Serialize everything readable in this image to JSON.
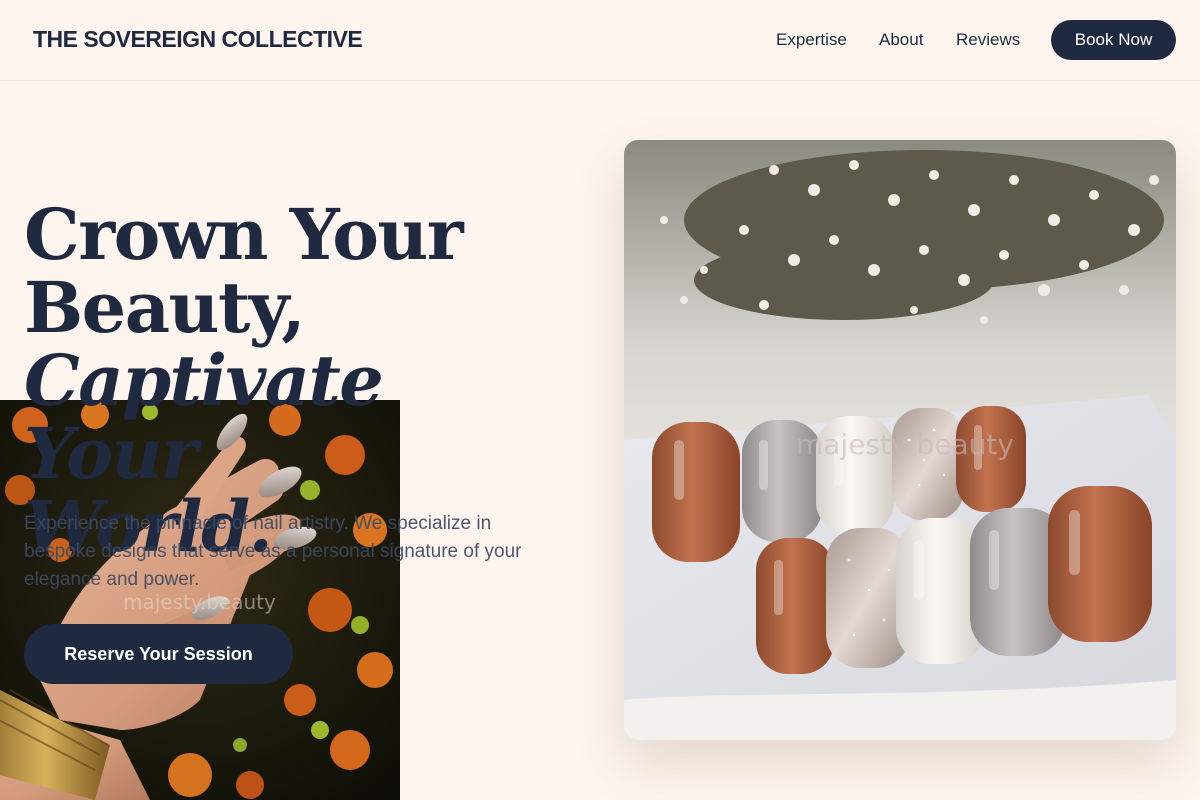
{
  "header": {
    "brand": "THE SOVEREIGN COLLECTIVE",
    "nav": {
      "expertise": "Expertise",
      "about": "About",
      "reviews": "Reviews"
    },
    "book_button": "Book Now"
  },
  "hero": {
    "title_line1": "Crown Your",
    "title_line2": "Beauty,",
    "title_line3": "Captivate Your",
    "title_line4": "World.",
    "description": "Experience the pinnacle of nail artistry. We specialize in bespoke designs that serve as a personal signature of your elegance and power.",
    "cta_button": "Reserve Your Session"
  },
  "images": {
    "hand_photo_watermark": "majesty.beauty",
    "nails_photo_watermark": "majesty beauty"
  },
  "colors": {
    "background": "#fdf5ee",
    "navy": "#1f2a40",
    "text_muted": "#3e4a63"
  }
}
